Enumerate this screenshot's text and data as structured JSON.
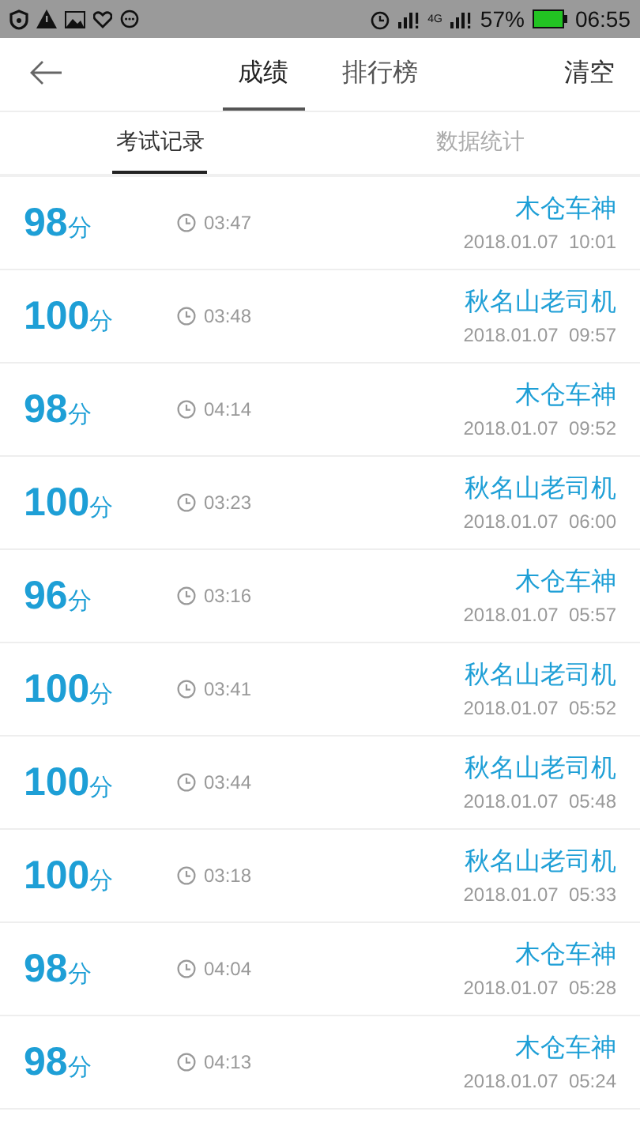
{
  "status_bar": {
    "network": "4G",
    "battery": "57%",
    "time": "06:55"
  },
  "header": {
    "tabs": [
      {
        "label": "成绩",
        "selected": true
      },
      {
        "label": "排行榜",
        "selected": false
      }
    ],
    "action": "清空"
  },
  "sub_tabs": [
    {
      "label": "考试记录",
      "selected": true
    },
    {
      "label": "数据统计",
      "selected": false
    }
  ],
  "records": [
    {
      "score": "98",
      "unit": "分",
      "duration": "03:47",
      "name": "木仓车神",
      "date": "2018.01.07  10:01"
    },
    {
      "score": "100",
      "unit": "分",
      "duration": "03:48",
      "name": "秋名山老司机",
      "date": "2018.01.07  09:57"
    },
    {
      "score": "98",
      "unit": "分",
      "duration": "04:14",
      "name": "木仓车神",
      "date": "2018.01.07  09:52"
    },
    {
      "score": "100",
      "unit": "分",
      "duration": "03:23",
      "name": "秋名山老司机",
      "date": "2018.01.07  06:00"
    },
    {
      "score": "96",
      "unit": "分",
      "duration": "03:16",
      "name": "木仓车神",
      "date": "2018.01.07  05:57"
    },
    {
      "score": "100",
      "unit": "分",
      "duration": "03:41",
      "name": "秋名山老司机",
      "date": "2018.01.07  05:52"
    },
    {
      "score": "100",
      "unit": "分",
      "duration": "03:44",
      "name": "秋名山老司机",
      "date": "2018.01.07  05:48"
    },
    {
      "score": "100",
      "unit": "分",
      "duration": "03:18",
      "name": "秋名山老司机",
      "date": "2018.01.07  05:33"
    },
    {
      "score": "98",
      "unit": "分",
      "duration": "04:04",
      "name": "木仓车神",
      "date": "2018.01.07  05:28"
    },
    {
      "score": "98",
      "unit": "分",
      "duration": "04:13",
      "name": "木仓车神",
      "date": "2018.01.07  05:24"
    }
  ]
}
